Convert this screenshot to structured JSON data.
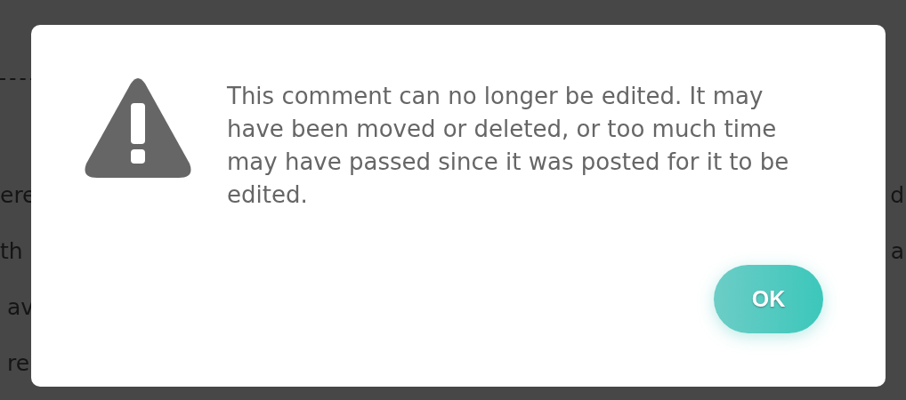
{
  "background": {
    "rows": [
      {
        "left": "ere",
        "right": "d"
      },
      {
        "left": "th",
        "right": "a"
      },
      {
        "left": "av",
        "right": ""
      },
      {
        "left": "re",
        "right": ""
      }
    ]
  },
  "dialog": {
    "message": "This comment can no longer be edited. It may have been moved or deleted, or too much time may have passed since it was posted for it to be edited.",
    "buttons": [
      {
        "label": "OK"
      }
    ]
  }
}
